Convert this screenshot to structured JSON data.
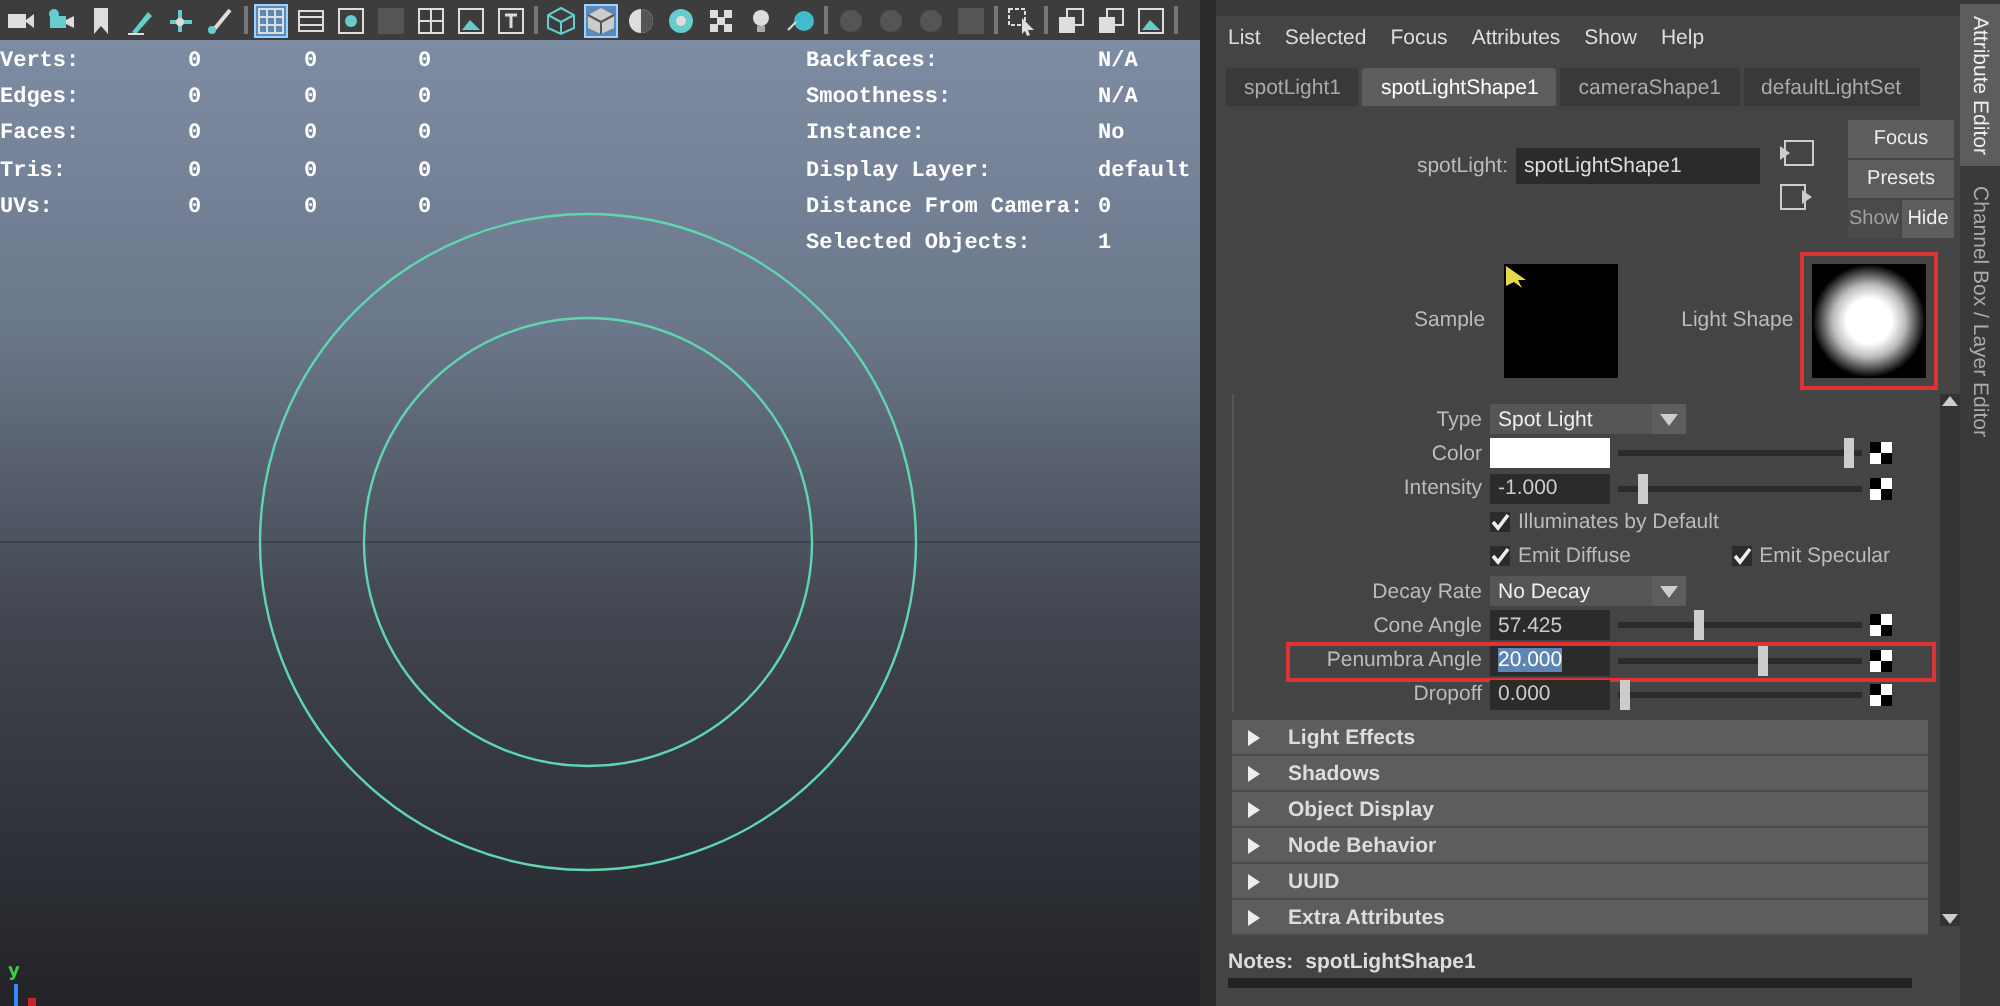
{
  "viewport": {
    "toolbar": [
      {
        "kind": "camera",
        "selected": false
      },
      {
        "kind": "camera-plus",
        "selected": false
      },
      {
        "kind": "bookmark",
        "selected": false
      },
      {
        "kind": "pen",
        "selected": false
      },
      {
        "kind": "move",
        "selected": false
      },
      {
        "kind": "brush",
        "selected": false
      },
      {
        "kind": "separator"
      },
      {
        "kind": "grid",
        "selected": true
      },
      {
        "kind": "film",
        "selected": false
      },
      {
        "kind": "dot-square",
        "selected": false
      },
      {
        "kind": "dark-square",
        "selected": false
      },
      {
        "kind": "quad",
        "selected": false
      },
      {
        "kind": "image",
        "selected": false
      },
      {
        "kind": "text-box",
        "selected": false
      },
      {
        "kind": "separator"
      },
      {
        "kind": "cube-wire",
        "selected": false
      },
      {
        "kind": "cube",
        "selected": true
      },
      {
        "kind": "half-circle",
        "selected": false
      },
      {
        "kind": "sphere",
        "selected": false
      },
      {
        "kind": "checker",
        "selected": false
      },
      {
        "kind": "bulb",
        "selected": false
      },
      {
        "kind": "blue-dot",
        "selected": false
      },
      {
        "kind": "separator"
      },
      {
        "kind": "dim-circle",
        "selected": false
      },
      {
        "kind": "dim-circle",
        "selected": false
      },
      {
        "kind": "dim-circle",
        "selected": false
      },
      {
        "kind": "dark-square",
        "selected": false
      },
      {
        "kind": "separator"
      },
      {
        "kind": "select-arrow",
        "selected": false
      },
      {
        "kind": "separator"
      },
      {
        "kind": "windows",
        "selected": false
      },
      {
        "kind": "windows",
        "selected": false
      },
      {
        "kind": "image",
        "selected": false
      },
      {
        "kind": "separator"
      }
    ],
    "stats": [
      {
        "label": "Verts:",
        "values": [
          "0",
          "0",
          "0"
        ]
      },
      {
        "label": "Edges:",
        "values": [
          "0",
          "0",
          "0"
        ]
      },
      {
        "label": "Faces:",
        "values": [
          "0",
          "0",
          "0"
        ]
      },
      {
        "label": "Tris:",
        "values": [
          "0",
          "0",
          "0"
        ]
      },
      {
        "label": "UVs:",
        "values": [
          "0",
          "0",
          "0"
        ]
      }
    ],
    "info": [
      {
        "label": "Backfaces:",
        "value": "N/A"
      },
      {
        "label": "Smoothness:",
        "value": "N/A"
      },
      {
        "label": "Instance:",
        "value": "No"
      },
      {
        "label": "Display Layer:",
        "value": "default"
      },
      {
        "label": "Distance From Camera:",
        "value": "0"
      },
      {
        "label": "Selected Objects:",
        "value": "1"
      }
    ],
    "axis_label": "y"
  },
  "attribute_editor": {
    "menu": [
      "List",
      "Selected",
      "Focus",
      "Attributes",
      "Show",
      "Help"
    ],
    "tabs": [
      {
        "label": "spotLight1",
        "selected": false
      },
      {
        "label": "spotLightShape1",
        "selected": true
      },
      {
        "label": "cameraShape1",
        "selected": false
      },
      {
        "label": "defaultLightSet",
        "selected": false
      }
    ],
    "node_label": "spotLight:",
    "node_name": "spotLightShape1",
    "buttons": [
      {
        "label": "Focus",
        "disabled": false
      },
      {
        "label": "Presets",
        "disabled": false
      },
      {
        "label": "Show",
        "disabled": true
      },
      {
        "label": "Hide",
        "disabled": false
      }
    ],
    "swatches": [
      {
        "label": "Sample",
        "kind": "sample",
        "highlighted": false
      },
      {
        "label": "Light Shape",
        "kind": "light-shape",
        "highlighted": true
      }
    ],
    "attributes": [
      {
        "kind": "dropdown",
        "label": "Type",
        "value": "Spot Light",
        "highlighted": false
      },
      {
        "kind": "color",
        "label": "Color",
        "level": 0.97,
        "highlighted": false
      },
      {
        "kind": "slider",
        "label": "Intensity",
        "value": "-1.000",
        "level": 0.08,
        "value_selected": false,
        "highlighted": false
      },
      {
        "kind": "checkboxes",
        "items": [
          {
            "label": "Illuminates by Default",
            "checked": true
          }
        ],
        "highlighted": false
      },
      {
        "kind": "checkboxes",
        "items": [
          {
            "label": "Emit Diffuse",
            "checked": true
          },
          {
            "label": "Emit Specular",
            "checked": true
          }
        ],
        "highlighted": false
      },
      {
        "kind": "dropdown",
        "label": "Decay Rate",
        "value": "No Decay",
        "highlighted": false
      },
      {
        "kind": "slider",
        "label": "Cone Angle",
        "value": "57.425",
        "level": 0.32,
        "value_selected": false,
        "highlighted": false
      },
      {
        "kind": "slider",
        "label": "Penumbra Angle",
        "value": "20.000",
        "level": 0.6,
        "value_selected": true,
        "highlighted": true
      },
      {
        "kind": "slider",
        "label": "Dropoff",
        "value": "0.000",
        "level": 0.0,
        "value_selected": false,
        "highlighted": false
      }
    ],
    "sections": [
      {
        "label": "Light Effects",
        "expanded": false
      },
      {
        "label": "Shadows",
        "expanded": false
      },
      {
        "label": "Object Display",
        "expanded": false
      },
      {
        "label": "Node Behavior",
        "expanded": false
      },
      {
        "label": "UUID",
        "expanded": false
      },
      {
        "label": "Extra Attributes",
        "expanded": false
      }
    ],
    "notes_label": "Notes:",
    "notes_value": "spotLightShape1"
  },
  "side_tabs": [
    {
      "label": "Attribute Editor",
      "selected": true
    },
    {
      "label": "Channel Box / Layer Editor",
      "selected": false
    }
  ]
}
